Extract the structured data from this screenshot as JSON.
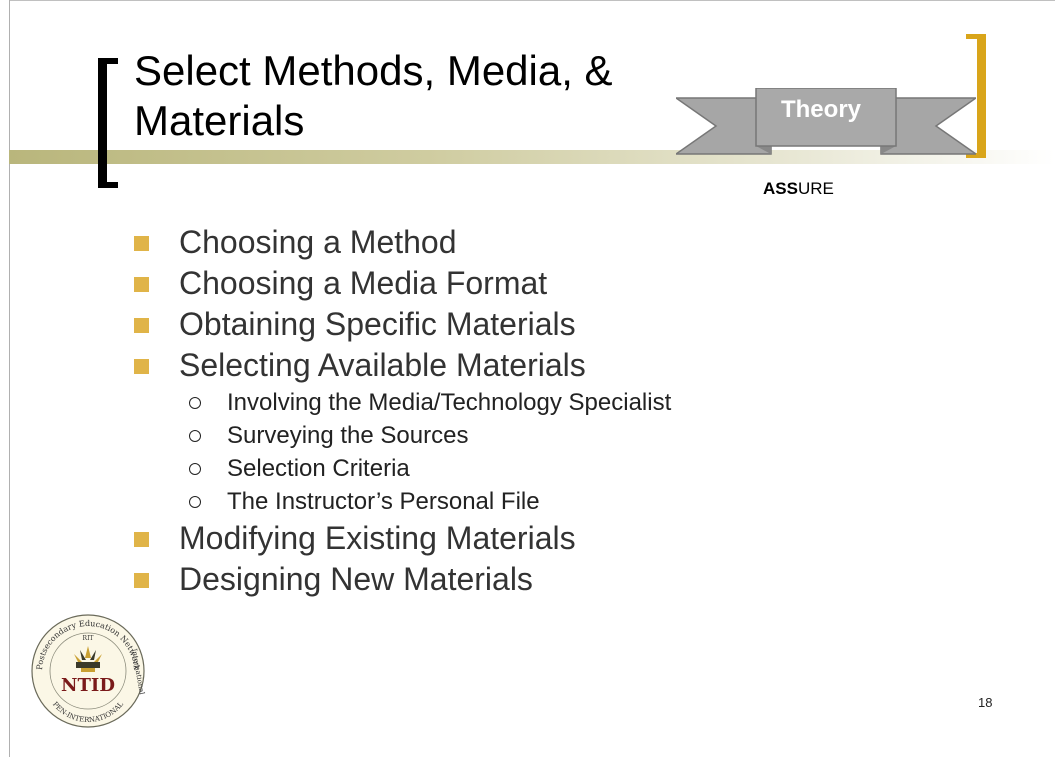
{
  "title": "Select Methods, Media, & Materials",
  "ribbon_label": "Theory",
  "assure": {
    "bold": "ASS",
    "regular": "URE"
  },
  "bullets": [
    {
      "text": "Choosing a Method"
    },
    {
      "text": "Choosing a Media Format"
    },
    {
      "text": "Obtaining Specific Materials"
    },
    {
      "text": "Selecting Available Materials"
    },
    {
      "text": "Involving the Media/Technology Specialist"
    },
    {
      "text": "Surveying the Sources"
    },
    {
      "text": "Selection Criteria"
    },
    {
      "text": "The Instructor’s Personal File"
    },
    {
      "text": "Modifying Existing Materials"
    },
    {
      "text": "Designing New Materials"
    }
  ],
  "logo": {
    "center_text": "NTID",
    "ring_top": "Postsecondary Education Network",
    "ring_small": "RIT",
    "ring_right": "International",
    "ring_bottom": "PEN-INTERNATIONAL"
  },
  "page_number": "18",
  "colors": {
    "accent_gold": "#d9a51a",
    "bullet_square": "#e0b448",
    "ribbon_gray": "#a6a6a6",
    "band_olive": "#b9b67c"
  }
}
